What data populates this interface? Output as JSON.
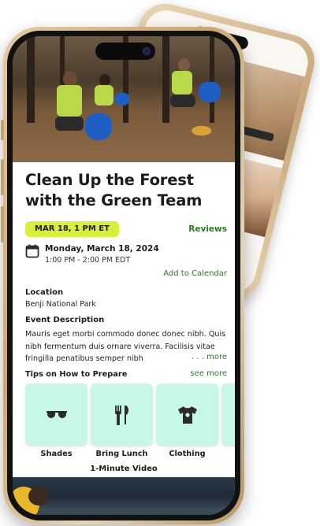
{
  "event": {
    "title": "Clean Up the Forest with the Green Team",
    "date_badge": "MAR 18, 1 PM ET",
    "reviews_link": "Reviews",
    "date_full": "Monday, March 18, 2024",
    "time_range": "1:00 PM - 2:00 PM EDT",
    "add_to_calendar": "Add to Calendar",
    "location_label": "Location",
    "location_value": "Benji National Park",
    "description_label": "Event Description",
    "description": "Mauris eget morbi commodo donec donec nibh. Quis nibh fermentum duis ornare viverra. Facilisis vitae fringilla penatibus semper nibh",
    "more_link": ". . . more"
  },
  "tips": {
    "title": "Tips on How to Prepare",
    "see_more": "see more",
    "items": [
      {
        "label": "Shades",
        "icon": "sunglasses-icon"
      },
      {
        "label": "Bring Lunch",
        "icon": "utensils-icon"
      },
      {
        "label": "Clothing",
        "icon": "shirt-icon"
      }
    ]
  },
  "video": {
    "title": "1-Minute Video"
  },
  "colors": {
    "accent_green": "#2c7a25",
    "badge_yellow": "#d8ef3b",
    "tile_mint": "#c7f7e5",
    "phone_gold": "#c9a874"
  }
}
